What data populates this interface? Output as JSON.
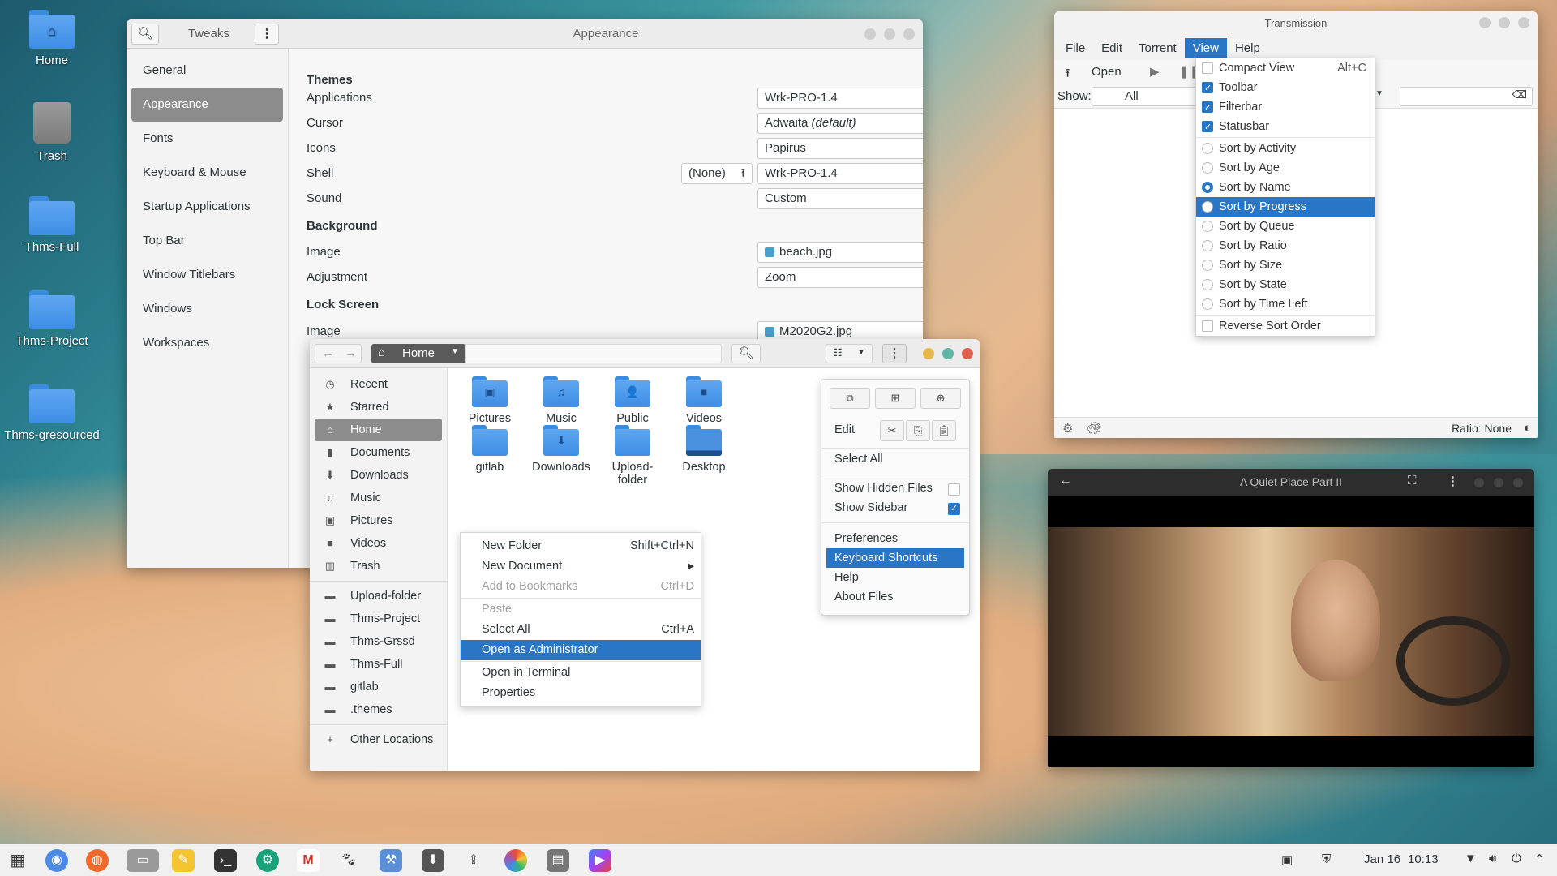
{
  "desktop": {
    "icons": [
      {
        "label": "Home",
        "icon": "home-folder-icon"
      },
      {
        "label": "Trash",
        "icon": "trash-icon"
      },
      {
        "label": "Thms-Full",
        "icon": "folder-icon"
      },
      {
        "label": "Thms-Project",
        "icon": "folder-icon"
      },
      {
        "label": "Thms-gresourced",
        "icon": "folder-icon"
      }
    ]
  },
  "tweaks": {
    "search_icon": "search-icon",
    "app_title": "Tweaks",
    "window_title": "Appearance",
    "sidebar": [
      "General",
      "Appearance",
      "Fonts",
      "Keyboard & Mouse",
      "Startup Applications",
      "Top Bar",
      "Window Titlebars",
      "Windows",
      "Workspaces"
    ],
    "selected": "Appearance",
    "themes_header": "Themes",
    "rows": [
      {
        "label": "Applications",
        "value": "Wrk-PRO-1.4"
      },
      {
        "label": "Cursor",
        "value": "Adwaita",
        "suffix": "(default)"
      },
      {
        "label": "Icons",
        "value": "Papirus"
      },
      {
        "label": "Shell",
        "value": "Wrk-PRO-1.4",
        "extra": "(None)"
      },
      {
        "label": "Sound",
        "value": "Custom"
      }
    ],
    "background_header": "Background",
    "bg_rows": [
      {
        "label": "Image",
        "value": "beach.jpg"
      },
      {
        "label": "Adjustment",
        "value": "Zoom"
      }
    ],
    "lock_header": "Lock Screen",
    "lock_rows": [
      {
        "label": "Image",
        "value": "M2020G2.jpg"
      }
    ]
  },
  "transmission": {
    "title": "Transmission",
    "menu": [
      "File",
      "Edit",
      "Torrent",
      "View",
      "Help"
    ],
    "active_menu": "View",
    "toolbar_open": "Open",
    "show_label": "Show:",
    "show_value": "All",
    "ratio": "Ratio: None",
    "view_menu": [
      {
        "label": "Compact View",
        "kind": "check",
        "checked": false,
        "accel": "Alt+C"
      },
      {
        "label": "Toolbar",
        "kind": "check",
        "checked": true
      },
      {
        "label": "Filterbar",
        "kind": "check",
        "checked": true
      },
      {
        "label": "Statusbar",
        "kind": "check",
        "checked": true
      },
      {
        "label": "Sort by Activity",
        "kind": "radio",
        "checked": false
      },
      {
        "label": "Sort by Age",
        "kind": "radio",
        "checked": false
      },
      {
        "label": "Sort by Name",
        "kind": "radio",
        "checked": true
      },
      {
        "label": "Sort by Progress",
        "kind": "radio",
        "checked": false,
        "highlight": true
      },
      {
        "label": "Sort by Queue",
        "kind": "radio",
        "checked": false
      },
      {
        "label": "Sort by Ratio",
        "kind": "radio",
        "checked": false
      },
      {
        "label": "Sort by Size",
        "kind": "radio",
        "checked": false
      },
      {
        "label": "Sort by State",
        "kind": "radio",
        "checked": false
      },
      {
        "label": "Sort by Time Left",
        "kind": "radio",
        "checked": false
      },
      {
        "label": "Reverse Sort Order",
        "kind": "check",
        "checked": false
      }
    ]
  },
  "files": {
    "path_label": "Home",
    "sidebar": [
      {
        "label": "Recent",
        "icon": "clock-icon"
      },
      {
        "label": "Starred",
        "icon": "star-icon"
      },
      {
        "label": "Home",
        "icon": "home-icon",
        "selected": true
      },
      {
        "label": "Documents",
        "icon": "document-icon"
      },
      {
        "label": "Downloads",
        "icon": "download-icon"
      },
      {
        "label": "Music",
        "icon": "music-icon"
      },
      {
        "label": "Pictures",
        "icon": "picture-icon"
      },
      {
        "label": "Videos",
        "icon": "video-icon"
      },
      {
        "label": "Trash",
        "icon": "trash-icon"
      }
    ],
    "bookmarks": [
      "Upload-folder",
      "Thms-Project",
      "Thms-Grssd",
      "Thms-Full",
      "gitlab",
      ".themes"
    ],
    "other_locations": "Other Locations",
    "items": [
      {
        "label": "Pictures",
        "glyph": "▣"
      },
      {
        "label": "Music",
        "glyph": "♫"
      },
      {
        "label": "Public",
        "glyph": "👤"
      },
      {
        "label": "Videos",
        "glyph": "■"
      },
      {
        "label": "gitlab",
        "glyph": ""
      },
      {
        "label": "Downloads",
        "glyph": "⬇"
      },
      {
        "label": "Upload-\nfolder",
        "glyph": ""
      },
      {
        "label": "Desktop",
        "glyph": ""
      }
    ],
    "context_menu": [
      {
        "label": "New Folder",
        "accel": "Shift+Ctrl+N"
      },
      {
        "label": "New Document",
        "accel": "▸"
      },
      {
        "label": "Add to Bookmarks",
        "accel": "Ctrl+D",
        "disabled": true
      },
      {
        "label": "Paste",
        "disabled": true
      },
      {
        "label": "Select All",
        "accel": "Ctrl+A"
      },
      {
        "label": "Open as Administrator",
        "highlight": true
      },
      {
        "label": "Open in Terminal"
      },
      {
        "label": "Properties"
      }
    ],
    "app_menu": {
      "edit": "Edit",
      "select_all": "Select All",
      "show_hidden": "Show Hidden Files",
      "show_hidden_checked": false,
      "show_sidebar": "Show Sidebar",
      "show_sidebar_checked": true,
      "items": [
        "Preferences",
        "Keyboard Shortcuts",
        "Help",
        "About Files"
      ],
      "highlight": "Keyboard Shortcuts"
    }
  },
  "video": {
    "title": "A Quiet Place Part II"
  },
  "taskbar": {
    "date": "Jan 16",
    "time": "10:13"
  }
}
